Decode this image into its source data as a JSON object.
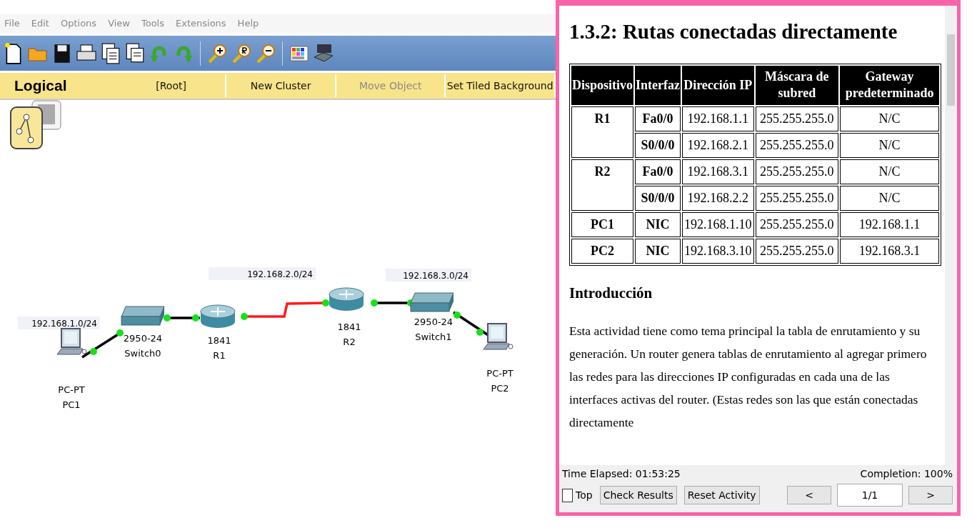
{
  "menu": [
    "File",
    "Edit",
    "Options",
    "View",
    "Tools",
    "Extensions",
    "Help"
  ],
  "workspace_bar": {
    "mode": "Logical",
    "items": [
      {
        "label": "[Root]",
        "disabled": false
      },
      {
        "label": "New Cluster",
        "disabled": false
      },
      {
        "label": "Move Object",
        "disabled": true
      },
      {
        "label": "Set Tiled Background",
        "disabled": false
      }
    ]
  },
  "subnets": [
    "192.168.1.0/24",
    "192.168.2.0/24",
    "192.168.3.0/24"
  ],
  "nodes": [
    {
      "kind": "pc",
      "model": "PC-PT",
      "name": "PC1"
    },
    {
      "kind": "switch",
      "model": "2950-24",
      "name": "Switch0"
    },
    {
      "kind": "router",
      "model": "1841",
      "name": "R1"
    },
    {
      "kind": "router",
      "model": "1841",
      "name": "R2"
    },
    {
      "kind": "switch",
      "model": "2950-24",
      "name": "Switch1"
    },
    {
      "kind": "pc",
      "model": "PC-PT",
      "name": "PC2"
    }
  ],
  "links": [
    {
      "kind": "ethernet"
    },
    {
      "kind": "ethernet"
    },
    {
      "kind": "serial"
    },
    {
      "kind": "ethernet"
    },
    {
      "kind": "ethernet"
    }
  ],
  "instructions": {
    "heading": "1.3.2: Rutas conectadas directamente",
    "table": {
      "columns": [
        "Dispositivo",
        "Interfaz",
        "Dirección IP",
        "Máscara de subred",
        "Gateway predeterminado"
      ],
      "devices": [
        {
          "name": "R1",
          "interfaces": [
            {
              "interface": "Fa0/0",
              "ip": "192.168.1.1",
              "mask": "255.255.255.0",
              "gateway": "N/C"
            },
            {
              "interface": "S0/0/0",
              "ip": "192.168.2.1",
              "mask": "255.255.255.0",
              "gateway": "N/C"
            }
          ]
        },
        {
          "name": "R2",
          "interfaces": [
            {
              "interface": "Fa0/0",
              "ip": "192.168.3.1",
              "mask": "255.255.255.0",
              "gateway": "N/C"
            },
            {
              "interface": "S0/0/0",
              "ip": "192.168.2.2",
              "mask": "255.255.255.0",
              "gateway": "N/C"
            }
          ]
        },
        {
          "name": "PC1",
          "interfaces": [
            {
              "interface": "NIC",
              "ip": "192.168.1.10",
              "mask": "255.255.255.0",
              "gateway": "192.168.1.1"
            }
          ]
        },
        {
          "name": "PC2",
          "interfaces": [
            {
              "interface": "NIC",
              "ip": "192.168.3.10",
              "mask": "255.255.255.0",
              "gateway": "192.168.3.1"
            }
          ]
        }
      ]
    },
    "section": "Introducción",
    "paragraph": "Esta actividad tiene como tema principal la tabla de enrutamiento y su generación. Un router genera tablas de enrutamiento al agregar primero las redes para las direcciones IP configuradas en cada una de las interfaces activas del router. (Estas redes son las que están conectadas directamente"
  },
  "footer": {
    "time": "Time Elapsed: 01:53:25",
    "completion": "Completion: 100%",
    "top": {
      "label": "Top",
      "checked": false
    },
    "buttons": [
      "Check Results",
      "Reset Activity"
    ],
    "prev": "<",
    "page": "1/1",
    "next": ">"
  }
}
